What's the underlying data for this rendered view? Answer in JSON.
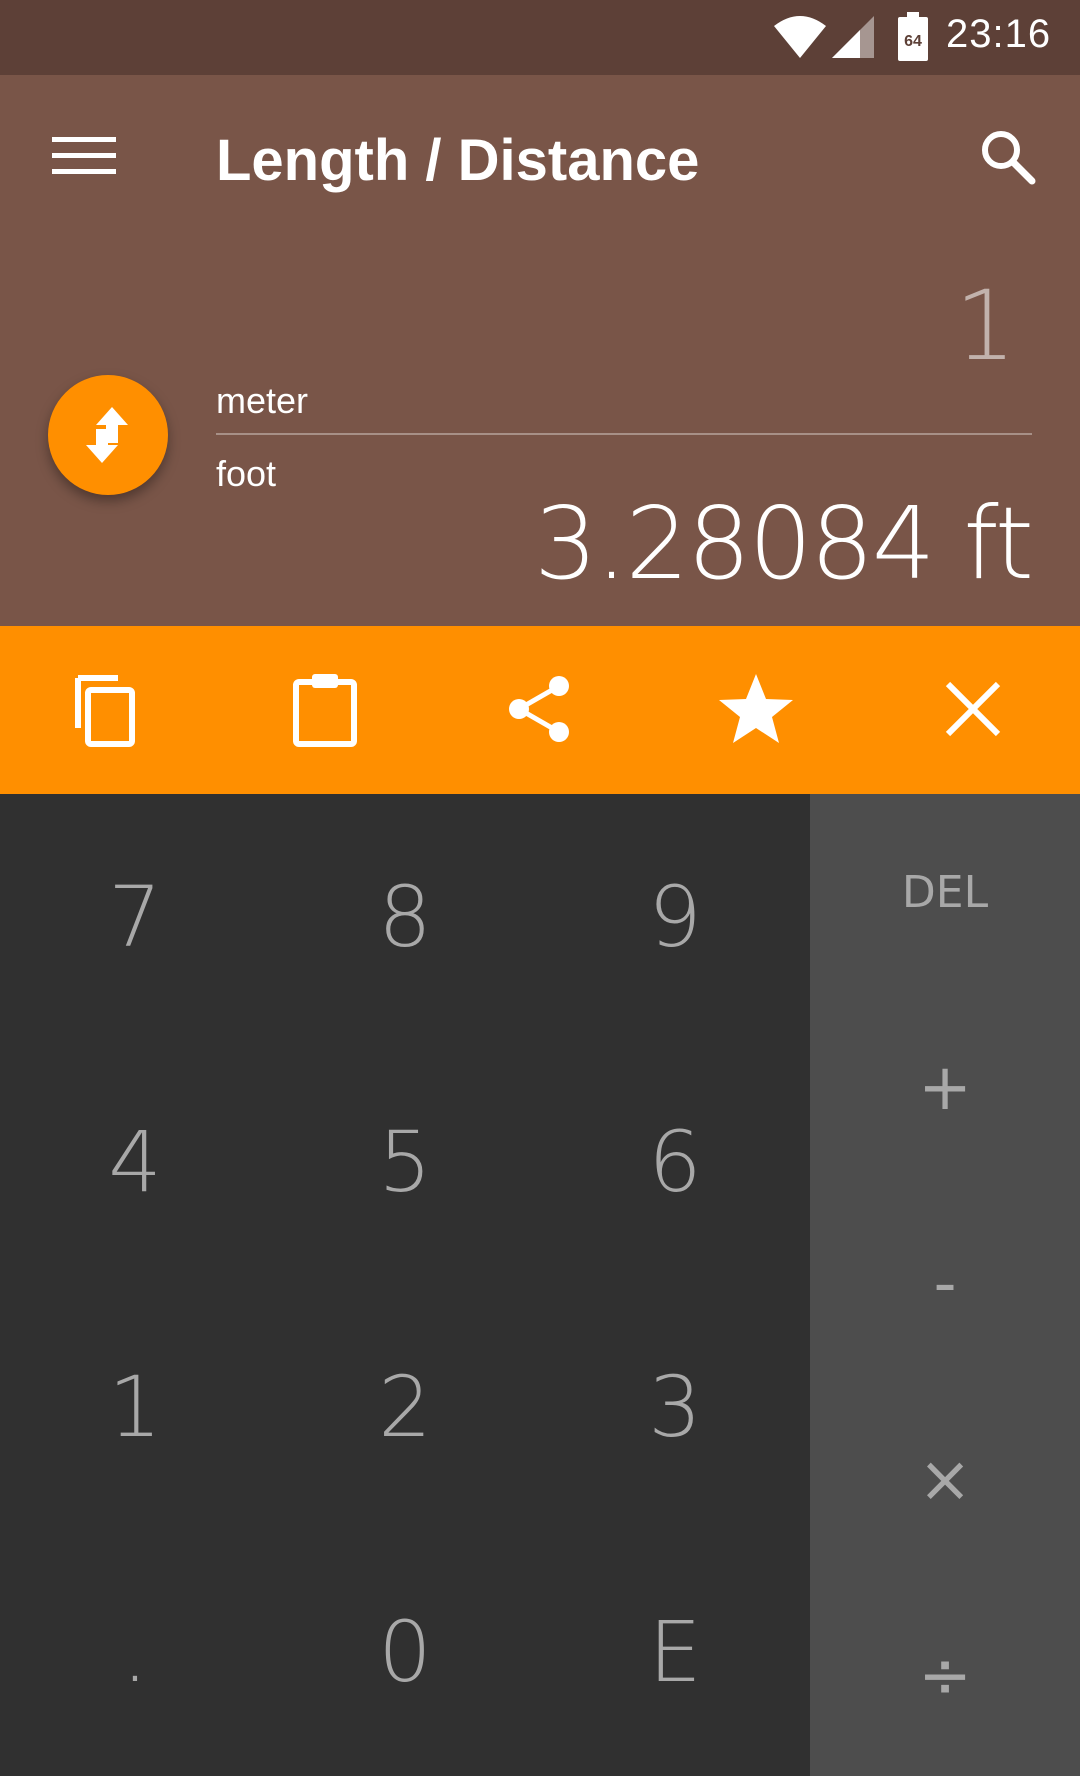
{
  "status_bar": {
    "time": "23:16",
    "battery_level": "64"
  },
  "header": {
    "title": "Length / Distance",
    "input_value": "1",
    "unit_from": "meter",
    "unit_to": "foot",
    "result_value": "3.28084 ft"
  },
  "colors": {
    "status_bar": "#5d4037",
    "header": "#795548",
    "accent": "#ff8f00",
    "keypad": "#303030",
    "operators": "#4d4d4d"
  },
  "action_bar": {
    "icons": [
      "copy-icon",
      "paste-icon",
      "share-icon",
      "star-icon",
      "close-icon"
    ]
  },
  "keypad": {
    "rows": [
      [
        "7",
        "8",
        "9"
      ],
      [
        "4",
        "5",
        "6"
      ],
      [
        "1",
        "2",
        "3"
      ],
      [
        ".",
        "0",
        "E"
      ]
    ]
  },
  "operators": [
    "DEL",
    "+",
    "-",
    "×",
    "÷"
  ]
}
